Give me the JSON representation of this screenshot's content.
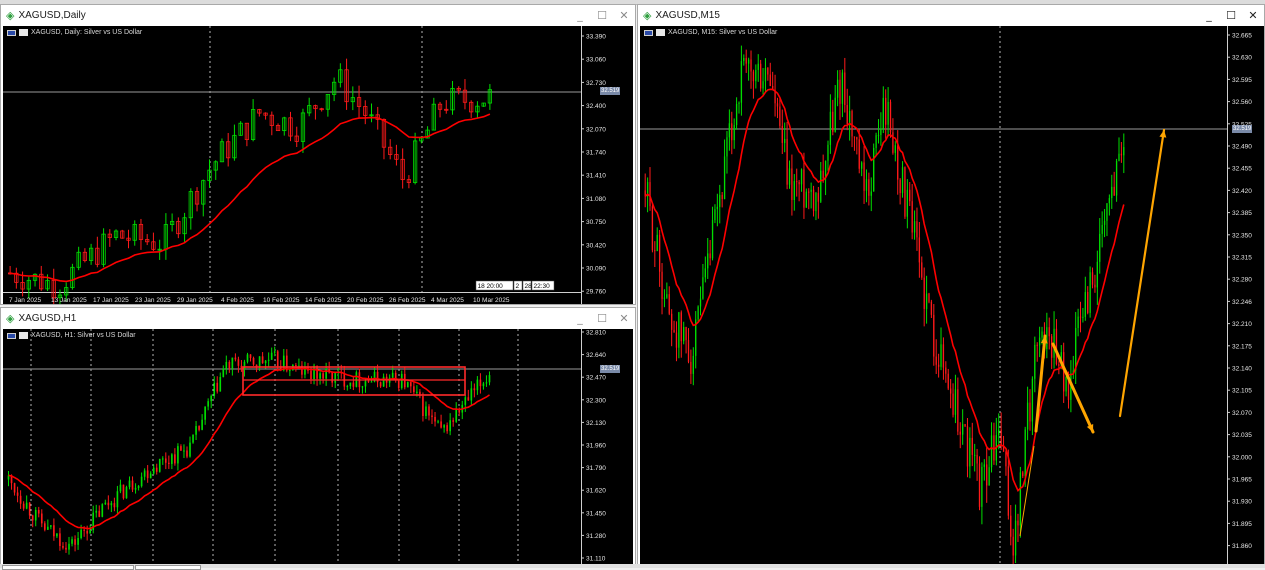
{
  "windows": {
    "daily": {
      "title": "XAGUSD,Daily",
      "label": "XAGUSD, Daily:  Silver vs US Dollar",
      "price_tag": "32.519",
      "y_ticks": [
        "33.390",
        "33.060",
        "32.730",
        "32.400",
        "32.070",
        "31.740",
        "31.410",
        "31.080",
        "30.750",
        "30.420",
        "30.090",
        "29.760"
      ],
      "x_ticks": [
        "7 Jan 2025",
        "13 Jan 2025",
        "17 Jan 2025",
        "23 Jan 2025",
        "29 Jan 2025",
        "4 Feb 2025",
        "10 Feb 2025",
        "14 Feb 2025",
        "20 Feb 2025",
        "26 Feb 2025",
        "4 Mar 2025",
        "10 Mar 2025"
      ],
      "time_boxes": [
        "18 20:00",
        "2",
        "28",
        "22:30"
      ]
    },
    "h1": {
      "title": "XAGUSD,H1",
      "label": "XAGUSD, H1:  Silver vs US Dollar",
      "price_tag": "32.519",
      "y_ticks": [
        "32.810",
        "32.640",
        "32.470",
        "32.300",
        "32.130",
        "31.960",
        "31.790",
        "31.620",
        "31.450",
        "31.280",
        "31.110"
      ]
    },
    "m15": {
      "title": "XAGUSD,M15",
      "label": "XAGUSD, M15:  Silver vs US Dollar",
      "price_tag": "32.519",
      "y_ticks": [
        "32.665",
        "32.630",
        "32.595",
        "32.560",
        "32.525",
        "32.490",
        "32.455",
        "32.420",
        "32.385",
        "32.350",
        "32.315",
        "32.280",
        "32.246",
        "32.210",
        "32.175",
        "32.140",
        "32.105",
        "32.070",
        "32.035",
        "32.000",
        "31.965",
        "31.930",
        "31.895",
        "31.860"
      ]
    }
  },
  "controls": {
    "minimize": "_",
    "maximize": "☐",
    "close": "✕"
  },
  "colors": {
    "chart_bg": "#000000",
    "bull": "#00dd00",
    "bear": "#ff1a1a",
    "ma": "#ff0000",
    "arrow": "#ffa500",
    "grid": "#ffffff"
  }
}
